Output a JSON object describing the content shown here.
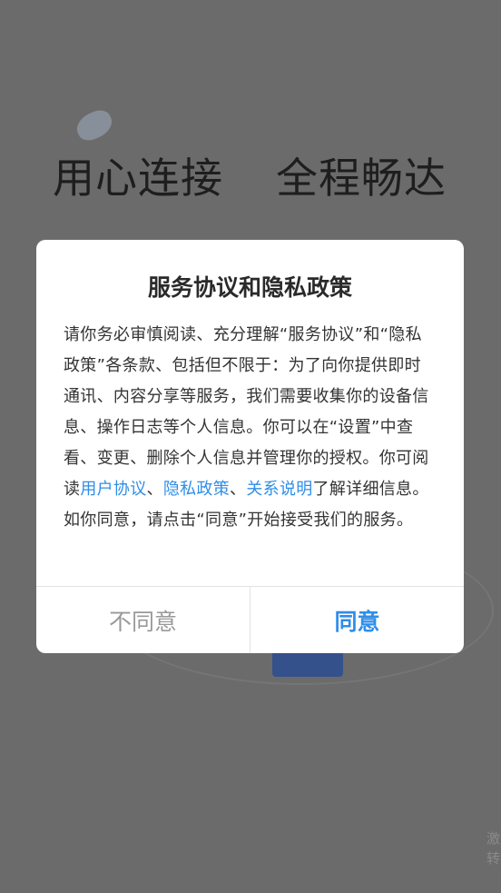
{
  "splash": {
    "slogan_left": "用心连接",
    "slogan_right": "全程畅达",
    "corner_text": "激转"
  },
  "dialog": {
    "title": "服务协议和隐私政策",
    "body_before": "请你务必审慎阅读、充分理解“服务协议”和“隐私政策”各条款、包括但不限于：为了向你提供即时通讯、内容分享等服务，我们需要收集你的设备信息、操作日志等个人信息。你可以在“设置”中查看、变更、删除个人信息并管理你的授权。你可阅读",
    "link_user_agreement": "用户协议",
    "sep1": "、",
    "link_privacy_policy": "隐私政策",
    "sep2": "、",
    "link_relation": "关系说明",
    "body_after": "了解详细信息。如你同意，请点击“同意”开始接受我们的服务。",
    "disagree_label": "不同意",
    "agree_label": "同意"
  },
  "colors": {
    "overlay": "#6b6b6b",
    "link": "#2f8ee8",
    "agree": "#2f8ee8",
    "disagree": "#999999"
  }
}
